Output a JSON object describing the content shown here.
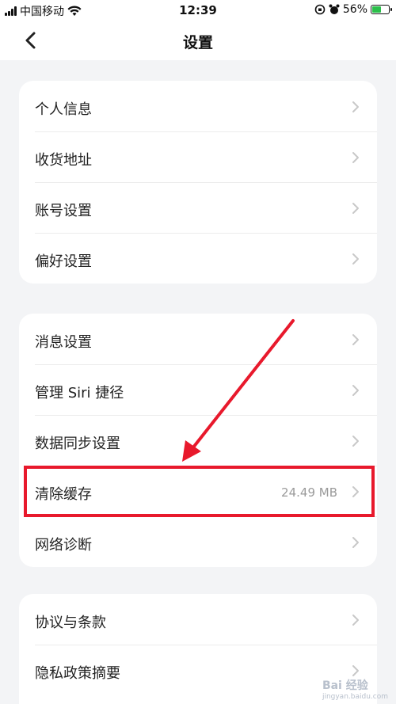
{
  "status_bar": {
    "carrier": "中国移动",
    "time": "12:39",
    "battery_percent": "56%",
    "battery_level": 0.56,
    "icons": [
      "signal-icon",
      "wifi-icon",
      "lock-rotation-icon",
      "alarm-icon",
      "battery-charging-icon"
    ]
  },
  "nav": {
    "title": "设置",
    "back_icon": "chevron-left-icon"
  },
  "groups": [
    {
      "items": [
        {
          "label": "个人信息"
        },
        {
          "label": "收货地址"
        },
        {
          "label": "账号设置"
        },
        {
          "label": "偏好设置"
        }
      ]
    },
    {
      "items": [
        {
          "label": "消息设置"
        },
        {
          "label": "管理 Siri 捷径"
        },
        {
          "label": "数据同步设置"
        },
        {
          "label": "清除缓存",
          "value": "24.49 MB"
        },
        {
          "label": "网络诊断"
        }
      ]
    },
    {
      "items": [
        {
          "label": "协议与条款"
        },
        {
          "label": "隐私政策摘要"
        }
      ]
    }
  ],
  "annotation": {
    "highlight_color": "#e8192c"
  },
  "watermark": {
    "text": "Bai 经验",
    "sub": "jingyan.baidu.com"
  }
}
